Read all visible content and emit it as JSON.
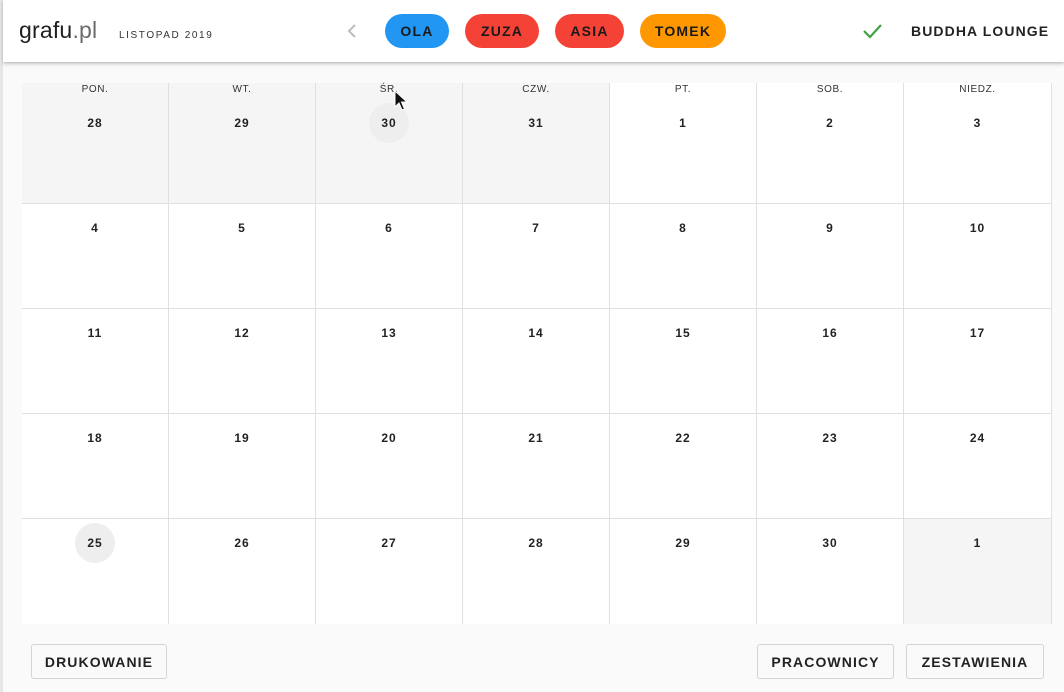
{
  "header": {
    "logo_main": "grafu",
    "logo_tld": ".pl",
    "month_label": "LISTOPAD 2019",
    "venue": "BUDDHA LOUNGE",
    "icons": {
      "prev": "chevron-left-icon",
      "confirm": "check-icon"
    },
    "employees": [
      {
        "name": "OLA",
        "color": "#2196f3",
        "text_color": "#1a1a1a"
      },
      {
        "name": "ZUZA",
        "color": "#f44336",
        "text_color": "#1a1a1a"
      },
      {
        "name": "ASIA",
        "color": "#f44336",
        "text_color": "#1a1a1a"
      },
      {
        "name": "TOMEK",
        "color": "#ff9800",
        "text_color": "#1a1a1a"
      }
    ]
  },
  "calendar": {
    "weekdays": [
      "PON.",
      "WT.",
      "ŚR.",
      "CZW.",
      "PT.",
      "SOB.",
      "NIEDZ."
    ],
    "weeks": [
      [
        "28",
        "29",
        "30",
        "31",
        "1",
        "2",
        "3"
      ],
      [
        "4",
        "5",
        "6",
        "7",
        "8",
        "9",
        "10"
      ],
      [
        "11",
        "12",
        "13",
        "14",
        "15",
        "16",
        "17"
      ],
      [
        "18",
        "19",
        "20",
        "21",
        "22",
        "23",
        "24"
      ],
      [
        "25",
        "26",
        "27",
        "28",
        "29",
        "30",
        "1"
      ]
    ],
    "outside_month": [
      [
        0,
        0
      ],
      [
        0,
        1
      ],
      [
        0,
        2
      ],
      [
        0,
        3
      ],
      [
        4,
        6
      ]
    ],
    "highlighted": [
      [
        0,
        2
      ],
      [
        4,
        0
      ]
    ]
  },
  "footer": {
    "print_label": "DRUKOWANIE",
    "employees_label": "PRACOWNICY",
    "reports_label": "ZESTAWIENIA"
  },
  "colors": {
    "accent_green": "#43a047"
  }
}
